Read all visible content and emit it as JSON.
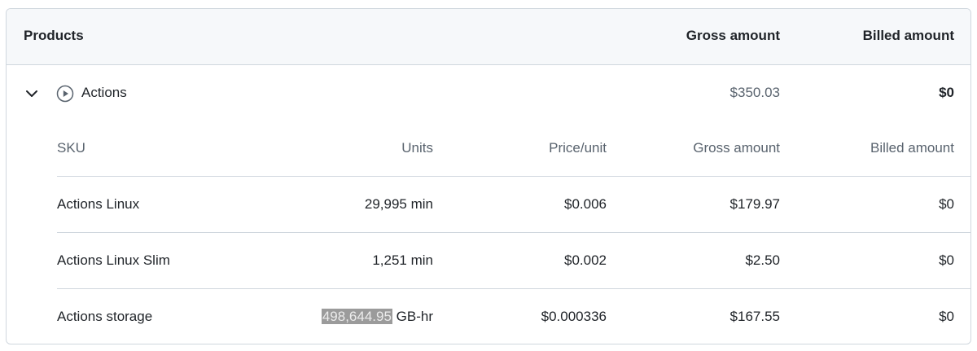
{
  "header": {
    "products": "Products",
    "gross_amount": "Gross amount",
    "billed_amount": "Billed amount"
  },
  "product": {
    "name": "Actions",
    "gross": "$350.03",
    "billed": "$0",
    "icon": "play-circle-icon",
    "expand_icon": "chevron-down-icon"
  },
  "sku_table": {
    "columns": [
      "SKU",
      "Units",
      "Price/unit",
      "Gross amount",
      "Billed amount"
    ],
    "rows": [
      {
        "sku": "Actions Linux",
        "units_value": "29,995",
        "units_unit": "min",
        "price": "$0.006",
        "gross": "$179.97",
        "billed": "$0"
      },
      {
        "sku": "Actions Linux Slim",
        "units_value": "1,251",
        "units_unit": "min",
        "price": "$0.002",
        "gross": "$2.50",
        "billed": "$0"
      },
      {
        "sku": "Actions storage",
        "units_value": "498,644.95",
        "units_unit": "GB-hr",
        "price": "$0.000336",
        "gross": "$167.55",
        "billed": "$0"
      }
    ]
  },
  "colors": {
    "border": "#d0d7de",
    "header_bg": "#f6f8fa",
    "muted_text": "#59636e",
    "text": "#1f2328",
    "highlight": "#9b9b9b"
  }
}
